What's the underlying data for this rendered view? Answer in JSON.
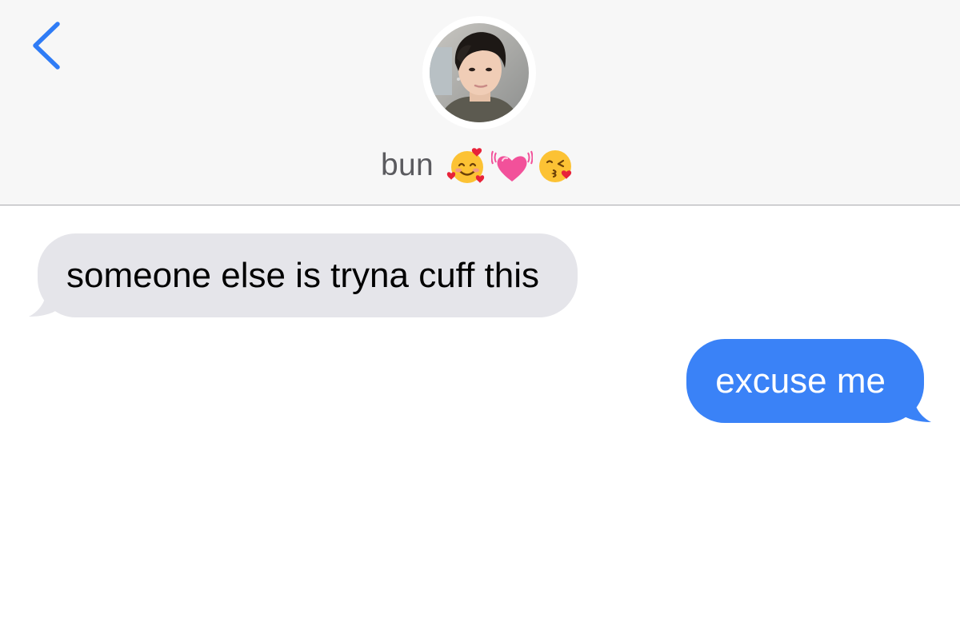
{
  "header": {
    "contact_name": "bun",
    "emojis": [
      "smiling-face-with-hearts-icon",
      "beating-heart-icon",
      "kissing-face-icon"
    ],
    "back_icon": "chevron-left-icon"
  },
  "messages": [
    {
      "direction": "incoming",
      "text": "someone else is tryna cuff this"
    },
    {
      "direction": "outgoing",
      "text": "excuse me"
    }
  ],
  "colors": {
    "accent": "#3a82f7",
    "incoming_bubble": "#e5e5ea",
    "header_bg": "#f7f7f7",
    "back_chevron": "#2f7cf6"
  }
}
